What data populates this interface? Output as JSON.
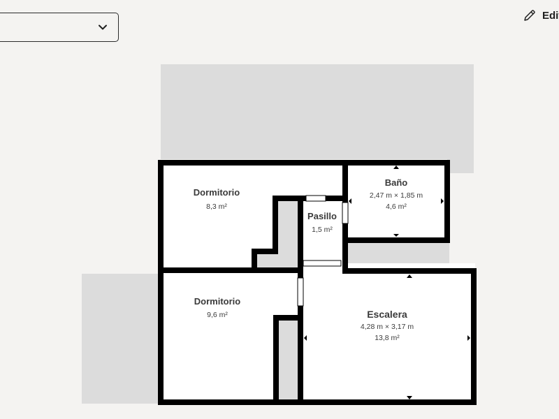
{
  "toolbar": {
    "floor_select_value": "",
    "chevron_icon": "chevron-down-icon",
    "edit_label": "Edit",
    "edit_icon": "pencil-icon"
  },
  "floorplan": {
    "rooms": [
      {
        "name": "Dormitorio",
        "dimensions": "",
        "area": "8,3 m²"
      },
      {
        "name": "Baño",
        "dimensions": "2,47 m × 1,85 m",
        "area": "4,6 m²"
      },
      {
        "name": "Pasillo",
        "dimensions": "",
        "area": "1,5 m²"
      },
      {
        "name": "Dormitorio",
        "dimensions": "",
        "area": "9,6 m²"
      },
      {
        "name": "Escalera",
        "dimensions": "4,28 m × 3,17 m",
        "area": "13,8 m²"
      }
    ],
    "colors": {
      "background": "#f4f3f1",
      "wall": "#000000",
      "room_fill": "#ffffff",
      "outdoor_area": "#dcdcdc",
      "text": "#3a3a3a"
    }
  }
}
